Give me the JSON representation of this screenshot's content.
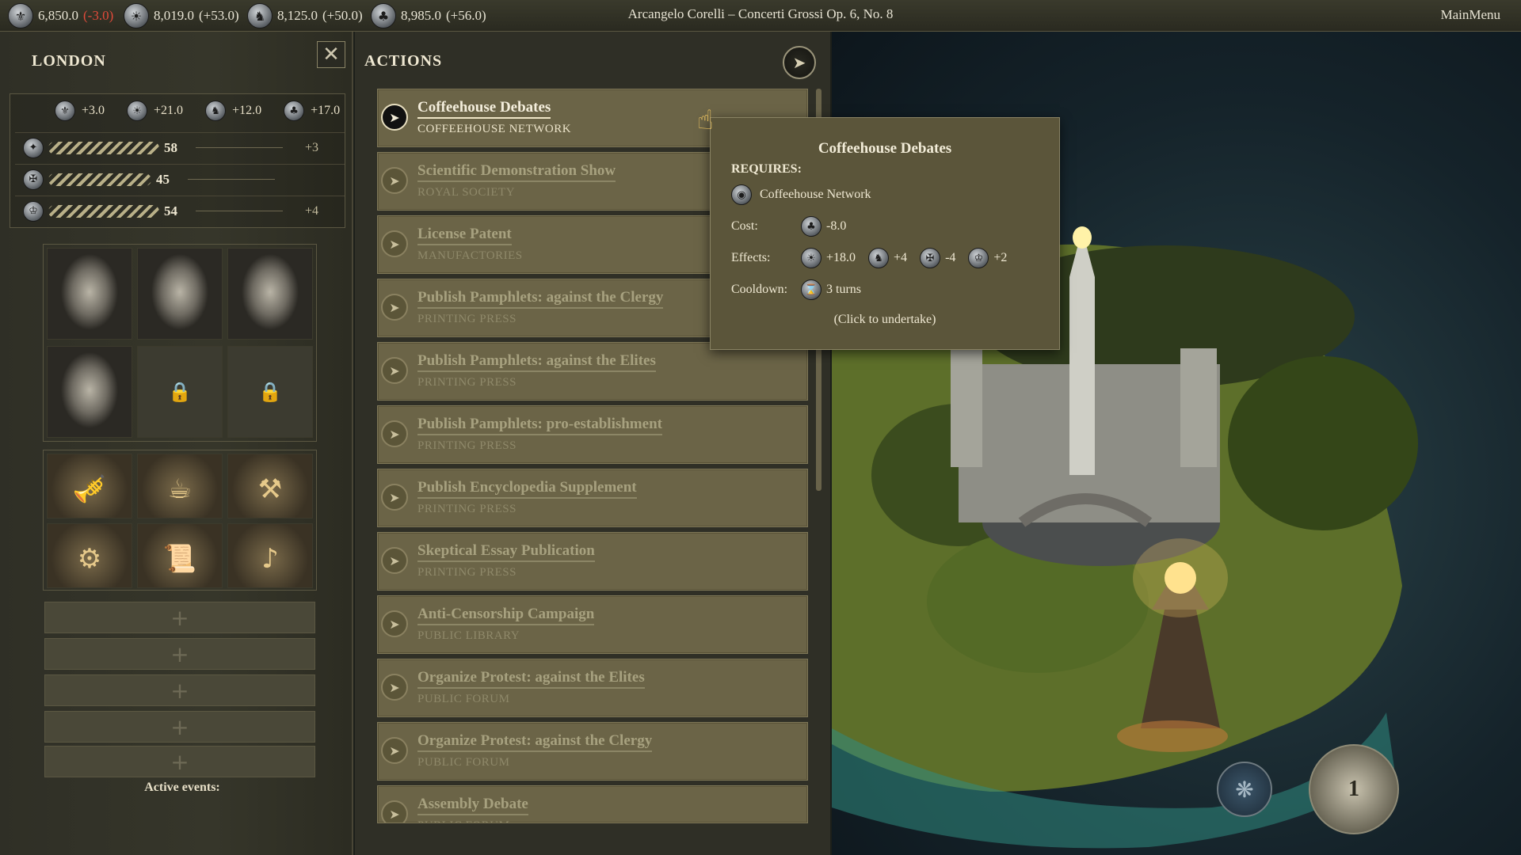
{
  "topbar": {
    "resources": [
      {
        "icon": "fleur-de-lis-icon",
        "value": "6,850.0",
        "delta": "(-3.0)",
        "negative": true
      },
      {
        "icon": "sun-icon",
        "value": "8,019.0",
        "delta": "(+53.0)",
        "negative": false
      },
      {
        "icon": "scholar-icon",
        "value": "8,125.0",
        "delta": "(+50.0)",
        "negative": false
      },
      {
        "icon": "tree-icon",
        "value": "8,985.0",
        "delta": "(+56.0)",
        "negative": false
      }
    ],
    "song": "Arcangelo Corelli – Concerti Grossi Op. 6, No. 8",
    "main_menu": "MainMenu"
  },
  "city": {
    "name": "LONDON",
    "close_glyph": "✕",
    "yields": [
      {
        "icon": "fleur-de-lis-icon",
        "value": "+3.0"
      },
      {
        "icon": "sun-icon",
        "value": "+21.0"
      },
      {
        "icon": "scholar-icon",
        "value": "+12.0"
      },
      {
        "icon": "tree-icon",
        "value": "+17.0"
      }
    ],
    "stats": [
      {
        "icon": "star-icon",
        "value": "58",
        "delta": "+3"
      },
      {
        "icon": "cross-icon",
        "value": "45",
        "delta": ""
      },
      {
        "icon": "crown-icon",
        "value": "54",
        "delta": "+4"
      }
    ],
    "portraits": [
      {
        "kind": "face"
      },
      {
        "kind": "face"
      },
      {
        "kind": "face"
      },
      {
        "kind": "face"
      },
      {
        "kind": "locked"
      },
      {
        "kind": "locked"
      }
    ],
    "buildings": [
      {
        "icon": "trumpet-icon",
        "glyph": "🎺"
      },
      {
        "icon": "coffee-icon",
        "glyph": "☕"
      },
      {
        "icon": "workshop-icon",
        "glyph": "⚒"
      },
      {
        "icon": "craftsman-icon",
        "glyph": "⚙"
      },
      {
        "icon": "scholar-reading-icon",
        "glyph": "📜"
      },
      {
        "icon": "musician-icon",
        "glyph": "♪"
      }
    ],
    "empty_slots": [
      "+",
      "+",
      "+",
      "+",
      "+"
    ],
    "active_events_label": "Active events:"
  },
  "actions": {
    "title": "ACTIONS",
    "items": [
      {
        "name": "Coffeehouse Debates",
        "category": "COFFEEHOUSE NETWORK",
        "active": true
      },
      {
        "name": "Scientific Demonstration Show",
        "category": "ROYAL SOCIETY",
        "active": false
      },
      {
        "name": "License Patent",
        "category": "MANUFACTORIES",
        "active": false
      },
      {
        "name": "Publish Pamphlets: against the Clergy",
        "category": "PRINTING PRESS",
        "active": false
      },
      {
        "name": "Publish Pamphlets: against the Elites",
        "category": "PRINTING PRESS",
        "active": false
      },
      {
        "name": "Publish Pamphlets: pro-establishment",
        "category": "PRINTING PRESS",
        "active": false
      },
      {
        "name": "Publish Encyclopedia Supplement",
        "category": "PRINTING PRESS",
        "active": false
      },
      {
        "name": "Skeptical Essay Publication",
        "category": "PRINTING PRESS",
        "active": false
      },
      {
        "name": "Anti-Censorship Campaign",
        "category": "PUBLIC LIBRARY",
        "active": false
      },
      {
        "name": "Organize Protest: against the Elites",
        "category": "PUBLIC FORUM",
        "active": false
      },
      {
        "name": "Organize Protest: against the Clergy",
        "category": "PUBLIC FORUM",
        "active": false
      },
      {
        "name": "Assembly Debate",
        "category": "PUBLIC FORUM",
        "active": false
      }
    ]
  },
  "tooltip": {
    "title": "Coffeehouse Debates",
    "requires_label": "REQUIRES:",
    "requires_item": "Coffeehouse Network",
    "cost_label": "Cost:",
    "cost_value": "-8.0",
    "effects_label": "Effects:",
    "effects": [
      {
        "icon": "sun-icon",
        "value": "+18.0"
      },
      {
        "icon": "scholar-icon",
        "value": "+4"
      },
      {
        "icon": "cross-icon",
        "value": "-4"
      },
      {
        "icon": "crown-icon",
        "value": "+2"
      }
    ],
    "cooldown_label": "Cooldown:",
    "cooldown_value": "3 turns",
    "click_hint": "(Click to undertake)"
  },
  "controls": {
    "turn_number": "1"
  },
  "colors": {
    "negative": "#e04a3a",
    "panel": "#2f2f26",
    "action_bg": "#6b6447",
    "tooltip_bg": "#5b553a",
    "sea": "#15232a"
  }
}
